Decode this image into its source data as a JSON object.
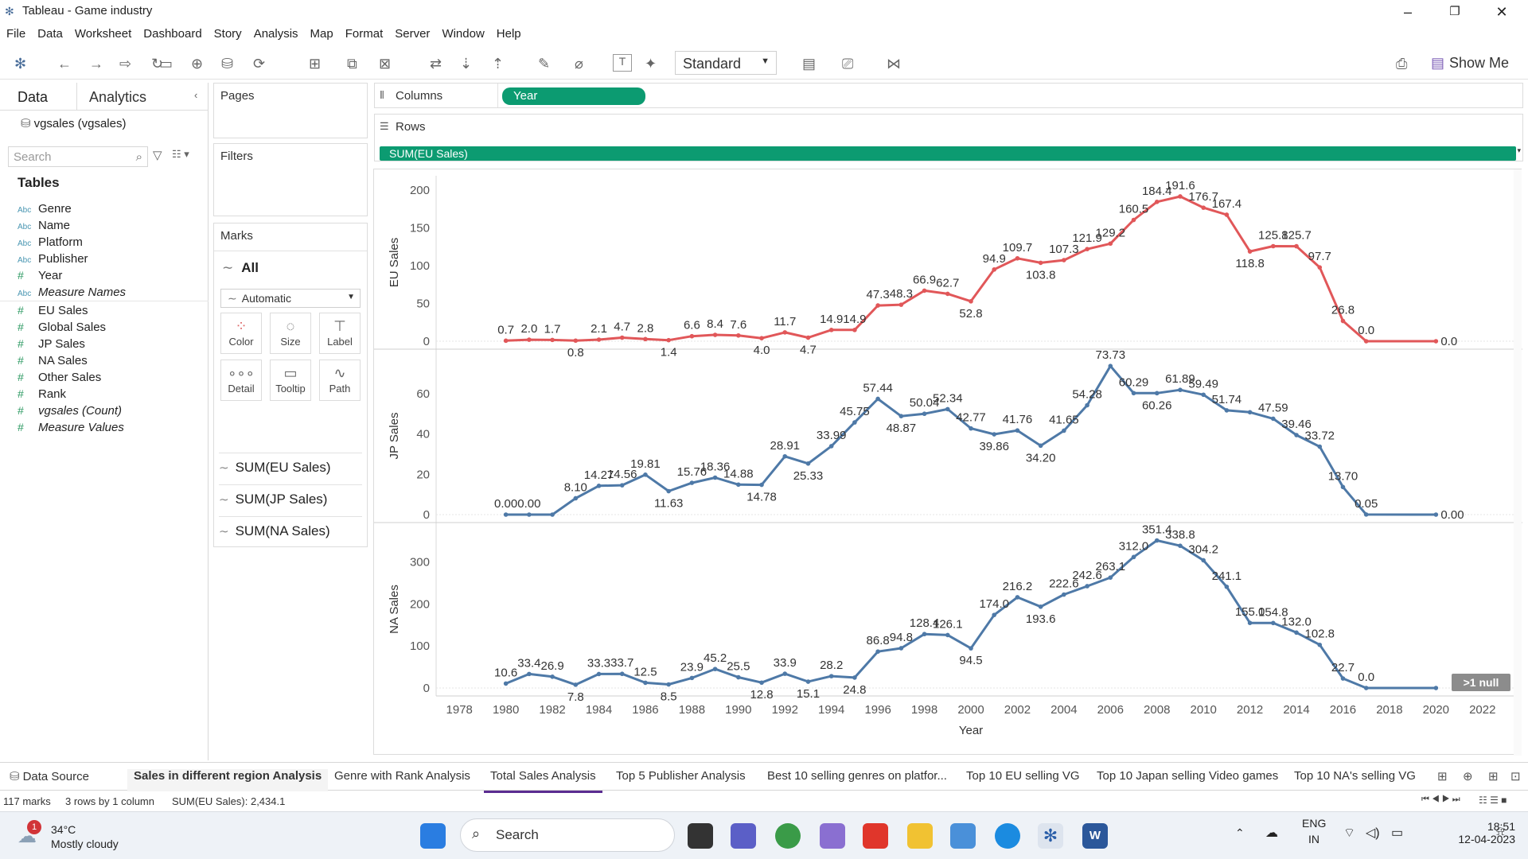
{
  "window": {
    "title": "Tableau - Game industry"
  },
  "menu": [
    "File",
    "Data",
    "Worksheet",
    "Dashboard",
    "Story",
    "Analysis",
    "Map",
    "Format",
    "Server",
    "Window",
    "Help"
  ],
  "toolbar": {
    "mark_type": "Standard",
    "show_me": "Show Me"
  },
  "datapane": {
    "tab_data": "Data",
    "tab_analytics": "Analytics",
    "datasource": "vgsales (vgsales)",
    "search_placeholder": "Search",
    "tables_header": "Tables",
    "fields": [
      {
        "label": "Genre",
        "type": "Abc",
        "italic": false
      },
      {
        "label": "Name",
        "type": "Abc",
        "italic": false
      },
      {
        "label": "Platform",
        "type": "Abc",
        "italic": false
      },
      {
        "label": "Publisher",
        "type": "Abc",
        "italic": false
      },
      {
        "label": "Year",
        "type": "#",
        "italic": false
      },
      {
        "label": "Measure Names",
        "type": "Abc",
        "italic": true
      },
      {
        "label": "EU Sales",
        "type": "#",
        "italic": false
      },
      {
        "label": "Global Sales",
        "type": "#",
        "italic": false
      },
      {
        "label": "JP Sales",
        "type": "#",
        "italic": false
      },
      {
        "label": "NA Sales",
        "type": "#",
        "italic": false
      },
      {
        "label": "Other Sales",
        "type": "#",
        "italic": false
      },
      {
        "label": "Rank",
        "type": "#",
        "italic": false
      },
      {
        "label": "vgsales (Count)",
        "type": "#",
        "italic": true
      },
      {
        "label": "Measure Values",
        "type": "#",
        "italic": true
      }
    ]
  },
  "shelves": {
    "pages": "Pages",
    "filters": "Filters",
    "marks": "Marks",
    "marks_all": "All",
    "marks_type": "Automatic",
    "columns": "Columns",
    "rows": "Rows",
    "column_pill": "Year",
    "row_pill": "SUM(EU Sales)"
  },
  "marks_buttons": [
    "Color",
    "Size",
    "Label",
    "Detail",
    "Tooltip",
    "Path"
  ],
  "marks_pills": [
    "SUM(EU Sales)",
    "SUM(JP Sales)",
    "SUM(NA Sales)"
  ],
  "chart_data": {
    "type": "line",
    "x_label": "Year",
    "x_ticks": [
      1978,
      1980,
      1982,
      1984,
      1986,
      1988,
      1990,
      1992,
      1994,
      1996,
      1998,
      2000,
      2002,
      2004,
      2006,
      2008,
      2010,
      2012,
      2014,
      2016,
      2018,
      2020,
      2022
    ],
    "x": [
      1980,
      1981,
      1982,
      1983,
      1984,
      1985,
      1986,
      1987,
      1988,
      1989,
      1990,
      1991,
      1992,
      1993,
      1994,
      1995,
      1996,
      1997,
      1998,
      1999,
      2000,
      2001,
      2002,
      2003,
      2004,
      2005,
      2006,
      2007,
      2008,
      2009,
      2010,
      2011,
      2012,
      2013,
      2014,
      2015,
      2016,
      2017,
      2020
    ],
    "series": [
      {
        "name": "EU Sales",
        "ylabel": "EU Sales",
        "color": "#e15759",
        "ylim": [
          0,
          200
        ],
        "yticks": [
          0,
          50,
          100,
          150,
          200
        ],
        "values": [
          0.7,
          2.0,
          1.7,
          0.8,
          2.1,
          4.7,
          2.8,
          1.4,
          6.6,
          8.4,
          7.6,
          4.0,
          11.7,
          4.7,
          14.9,
          14.9,
          47.3,
          48.3,
          66.9,
          62.7,
          52.8,
          94.9,
          109.7,
          103.8,
          107.3,
          121.9,
          129.2,
          160.5,
          184.4,
          191.6,
          176.7,
          167.4,
          118.8,
          125.8,
          125.7,
          97.7,
          26.8,
          0.0,
          0.0
        ]
      },
      {
        "name": "JP Sales",
        "ylabel": "JP Sales",
        "color": "#4e79a7",
        "ylim": [
          0,
          75
        ],
        "yticks": [
          0,
          20,
          40,
          60
        ],
        "values": [
          0.0,
          0.0,
          0.0,
          8.1,
          14.27,
          14.56,
          19.81,
          11.63,
          15.76,
          18.36,
          14.88,
          14.78,
          28.91,
          25.33,
          33.99,
          45.75,
          57.44,
          48.87,
          50.04,
          52.34,
          42.77,
          39.86,
          41.76,
          34.2,
          41.65,
          54.28,
          73.73,
          60.29,
          60.26,
          61.89,
          59.49,
          51.74,
          50.8,
          47.59,
          39.46,
          33.72,
          13.7,
          0.05,
          0.0
        ]
      },
      {
        "name": "NA Sales",
        "ylabel": "NA Sales",
        "color": "#4e79a7",
        "ylim": [
          0,
          360
        ],
        "yticks": [
          0,
          100,
          200,
          300
        ],
        "values": [
          10.6,
          33.4,
          26.9,
          7.8,
          33.3,
          33.7,
          12.5,
          8.5,
          23.9,
          45.2,
          25.5,
          12.8,
          33.9,
          15.1,
          28.2,
          24.8,
          86.8,
          94.8,
          128.4,
          126.1,
          94.5,
          174.0,
          216.2,
          193.6,
          222.6,
          242.6,
          263.1,
          312.0,
          351.4,
          338.8,
          304.2,
          241.1,
          155.0,
          154.8,
          132.0,
          102.8,
          22.7,
          0.0,
          0.0
        ]
      }
    ],
    "labels": {
      "EU Sales": [
        "0.7",
        "2.0",
        "1.7",
        "0.8",
        "2.1",
        "4.7",
        "2.8",
        "1.4",
        "6.6",
        "8.4",
        "7.6",
        "4.0",
        "11.7",
        "4.7",
        "14.9",
        "14.9",
        "47.3",
        "48.3",
        "66.9",
        "62.7",
        "52.8",
        "94.9",
        "109.7",
        "103.8",
        "107.3",
        "121.9",
        "129.2",
        "160.5",
        "184.4",
        "191.6",
        "176.7",
        "167.4",
        "118.8",
        "125.8",
        "125.7",
        "97.7",
        "26.8",
        "0.0",
        "0.0"
      ],
      "JP Sales": [
        "0.00",
        "0.00",
        "",
        "8.10",
        "14.27",
        "14.56",
        "19.81",
        "11.63",
        "15.76",
        "18.36",
        "14.88",
        "14.78",
        "28.91",
        "25.33",
        "33.99",
        "45.75",
        "57.44",
        "48.87",
        "50.04",
        "52.34",
        "42.77",
        "39.86",
        "41.76",
        "34.20",
        "41.65",
        "54.28",
        "73.73",
        "60.29",
        "60.26",
        "61.89",
        "59.49",
        "51.74",
        "",
        "47.59",
        "39.46",
        "33.72",
        "13.70",
        "0.05",
        "0.00"
      ],
      "NA Sales": [
        "10.6",
        "33.4",
        "26.9",
        "7.8",
        "33.3",
        "33.7",
        "12.5",
        "8.5",
        "23.9",
        "45.2",
        "25.5",
        "12.8",
        "33.9",
        "15.1",
        "28.2",
        "24.8",
        "86.8",
        "94.8",
        "128.4",
        "126.1",
        "94.5",
        "174.0",
        "216.2",
        "193.6",
        "222.6",
        "242.6",
        "263.1",
        "312.0",
        "351.4",
        "338.8",
        "304.2",
        "241.1",
        "155.0",
        "154.8",
        "132.0",
        "102.8",
        "22.7",
        "0.0",
        ""
      ]
    },
    "null_badge": ">1 null"
  },
  "sheet_tabs": [
    "Data Source",
    "Sales in different region Analysis",
    "Genre with Rank Analysis",
    "Total Sales Analysis",
    "Top 5 Publisher Analysis",
    "Best 10 selling genres on platfor...",
    "Top 10 EU selling VG",
    "Top 10 Japan selling Video games",
    "Top 10 NA's  selling VG"
  ],
  "status": {
    "marks": "117 marks",
    "rows": "3 rows by 1 column",
    "sum": "SUM(EU Sales): 2,434.1"
  },
  "taskbar": {
    "temp": "34°C",
    "weather": "Mostly cloudy",
    "search": "Search",
    "lang1": "ENG",
    "lang2": "IN",
    "time": "18:51",
    "date": "12-04-2023",
    "notif": "1"
  }
}
